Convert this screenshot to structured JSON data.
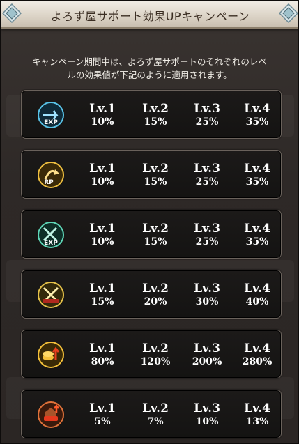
{
  "header": {
    "title": "よろず屋サポート効果UPキャンペーン"
  },
  "intro_text": "キャンペーン期間中は、よろず屋サポートのそれぞれのレベ\nルの効果値が下記のように適用されます。",
  "level_labels": [
    "Lv.1",
    "Lv.2",
    "Lv.3",
    "Lv.4"
  ],
  "effects": [
    {
      "icon": "exp-icon",
      "icon_text": "EXP",
      "icon_color": "#2f9fd0",
      "values": [
        "10%",
        "15%",
        "25%",
        "35%"
      ]
    },
    {
      "icon": "rp-icon",
      "icon_text": "RP",
      "icon_color": "#d8a21e",
      "values": [
        "10%",
        "15%",
        "25%",
        "35%"
      ]
    },
    {
      "icon": "weapon-exp-icon",
      "icon_text": "EXP",
      "icon_color": "#3ab39a",
      "values": [
        "10%",
        "15%",
        "25%",
        "35%"
      ]
    },
    {
      "icon": "weapon-skill-icon",
      "icon_text": "",
      "icon_color": "#c9a22a",
      "values": [
        "15%",
        "20%",
        "30%",
        "40%"
      ]
    },
    {
      "icon": "rupie-icon",
      "icon_text": "",
      "icon_color": "#e0a31c",
      "values": [
        "80%",
        "120%",
        "200%",
        "280%"
      ]
    },
    {
      "icon": "drop-icon",
      "icon_text": "",
      "icon_color": "#c2552e",
      "values": [
        "5%",
        "7%",
        "10%",
        "13%"
      ]
    }
  ]
}
